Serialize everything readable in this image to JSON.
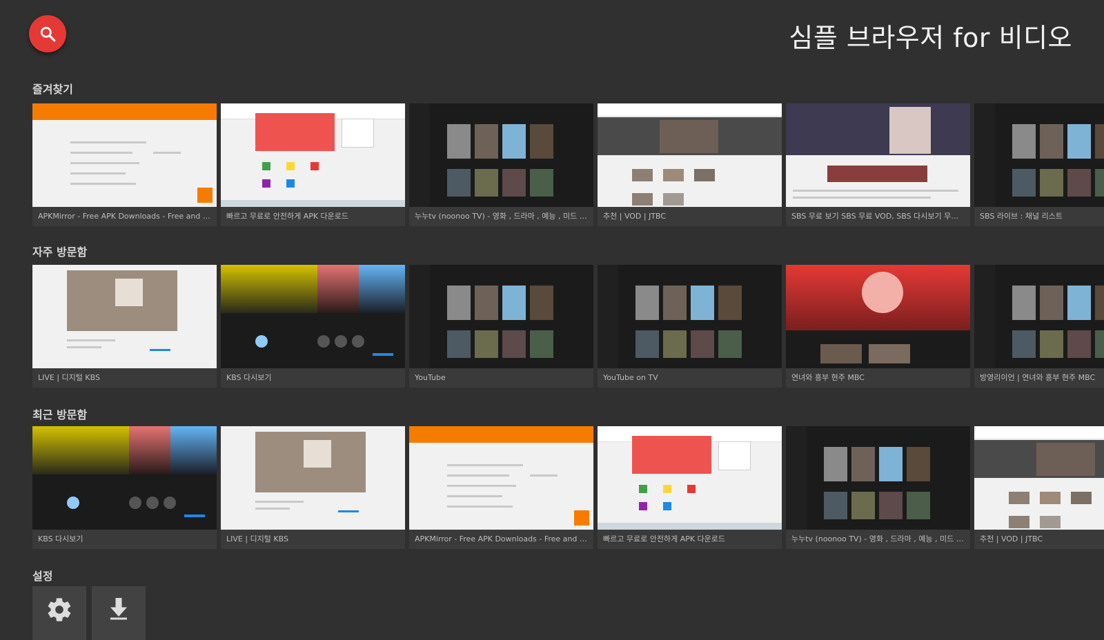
{
  "app": {
    "title": "심플 브라우저 for 비디오"
  },
  "icons": {
    "search": "search-icon",
    "settings": "gear-icon",
    "downloads": "download-arrow-icon"
  },
  "colors": {
    "background": "#303030",
    "accent": "#e53935",
    "card": "#3b3b3b"
  },
  "sections": [
    {
      "title": "즐겨찾기",
      "items": [
        {
          "caption": "APKMirror - Free APK Downloads - Free and safe An...",
          "theme": "orange"
        },
        {
          "caption": "빠르고 무료로 안전하게 APK 다운로드",
          "theme": "white-red"
        },
        {
          "caption": "누누tv (noonoo TV) - 영화 , 드라마 , 예능 , 미드 , 애니 ...",
          "theme": "dark-grid"
        },
        {
          "caption": "추천 | VOD | JTBC",
          "theme": "white-photos"
        },
        {
          "caption": "SBS 무료 보기 SBS 무료 VOD, SBS 다시보기 무료, S...",
          "theme": "white-banner"
        },
        {
          "caption": "SBS 라이브 : 채널 리스트",
          "theme": "dark-grid"
        }
      ]
    },
    {
      "title": "자주 방문함",
      "items": [
        {
          "caption": "LIVE | 디지털 KBS",
          "theme": "light-hero"
        },
        {
          "caption": "KBS 다시보기",
          "theme": "yellow-hero"
        },
        {
          "caption": "YouTube",
          "theme": "dark-grid"
        },
        {
          "caption": "YouTube on TV",
          "theme": "dark-grid"
        },
        {
          "caption": "연녀와 흥부 현주 MBC",
          "theme": "red-hero"
        },
        {
          "caption": "방영리이언 | 연녀와 흥부 현주 MBC",
          "theme": "dark-grid"
        }
      ]
    },
    {
      "title": "최근 방문함",
      "items": [
        {
          "caption": "KBS 다시보기",
          "theme": "yellow-hero"
        },
        {
          "caption": "LIVE | 디지털 KBS",
          "theme": "light-hero"
        },
        {
          "caption": "APKMirror - Free APK Downloads - Free and safe An...",
          "theme": "orange"
        },
        {
          "caption": "빠르고 무료로 안전하게 APK 다운로드",
          "theme": "white-red"
        },
        {
          "caption": "누누tv (noonoo TV) - 영화 , 드라마 , 예능 , 미드 , 애니 ...",
          "theme": "dark-grid"
        },
        {
          "caption": "추천 | VOD | JTBC",
          "theme": "white-photos"
        }
      ]
    },
    {
      "title": "설정",
      "items": []
    }
  ]
}
